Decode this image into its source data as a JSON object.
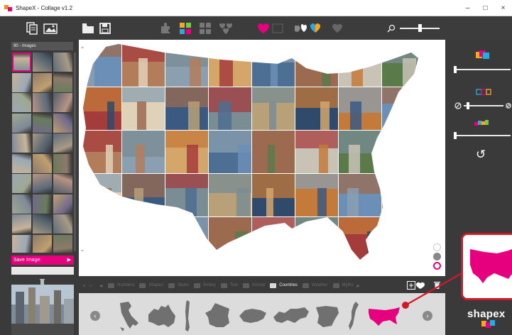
{
  "app": {
    "title": "ShapeX - Collage v1.2"
  },
  "window_controls": {
    "minimize": "–",
    "maximize": "□",
    "close": "×"
  },
  "left_panel": {
    "image_count_label": "90 - Images",
    "save_label": "Save Image:",
    "save_icon": "▶"
  },
  "categories": [
    {
      "label": "Numbers",
      "active": false
    },
    {
      "label": "Shapes",
      "active": false
    },
    {
      "label": "Skulls",
      "active": false
    },
    {
      "label": "Smiley",
      "active": false
    },
    {
      "label": "Text",
      "active": false
    },
    {
      "label": "Animal",
      "active": false
    },
    {
      "label": "Countries",
      "active": true
    },
    {
      "label": "Weather",
      "active": false
    },
    {
      "label": "Myths",
      "active": false
    }
  ],
  "shape_strip": {
    "prev_label": "‹",
    "next_label": "›",
    "shapes": [
      "italy",
      "australia",
      "chile",
      "france",
      "switzerland",
      "russia",
      "spain",
      "norway",
      "usa"
    ],
    "selected": "usa"
  },
  "branding": {
    "logo_text": "shapex"
  },
  "colors": {
    "accent": "#e6007e",
    "callout_border": "#d2182a",
    "background": "#3a3a3a"
  },
  "icons": {
    "undo": "↺",
    "nav_prev": "◂",
    "nav_next": "▸",
    "add": "+",
    "minus": "–"
  }
}
